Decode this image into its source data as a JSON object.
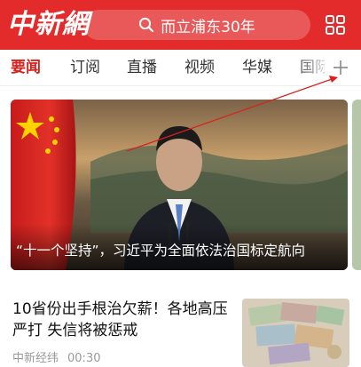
{
  "app": {
    "logo_text": "中新網"
  },
  "search": {
    "text": "而立浦东30年"
  },
  "tabs": [
    "要闻",
    "订阅",
    "直播",
    "视频",
    "华媒",
    "国际"
  ],
  "active_tab": "要闻",
  "hero": {
    "caption": "“十一个坚持”，习近平为全面依法治国标定航向"
  },
  "news": [
    {
      "title": "10省份出手根治欠薪！各地高压严打 失信将被惩戒",
      "source": "中新经纬",
      "time": "00:30"
    }
  ],
  "colors": {
    "brand_red": "#e32b2b",
    "active_tab": "#d9211d"
  },
  "icons": {
    "search": "search-icon",
    "grid": "grid-menu-icon",
    "add": "plus-icon",
    "audio": "speaker-icon"
  }
}
